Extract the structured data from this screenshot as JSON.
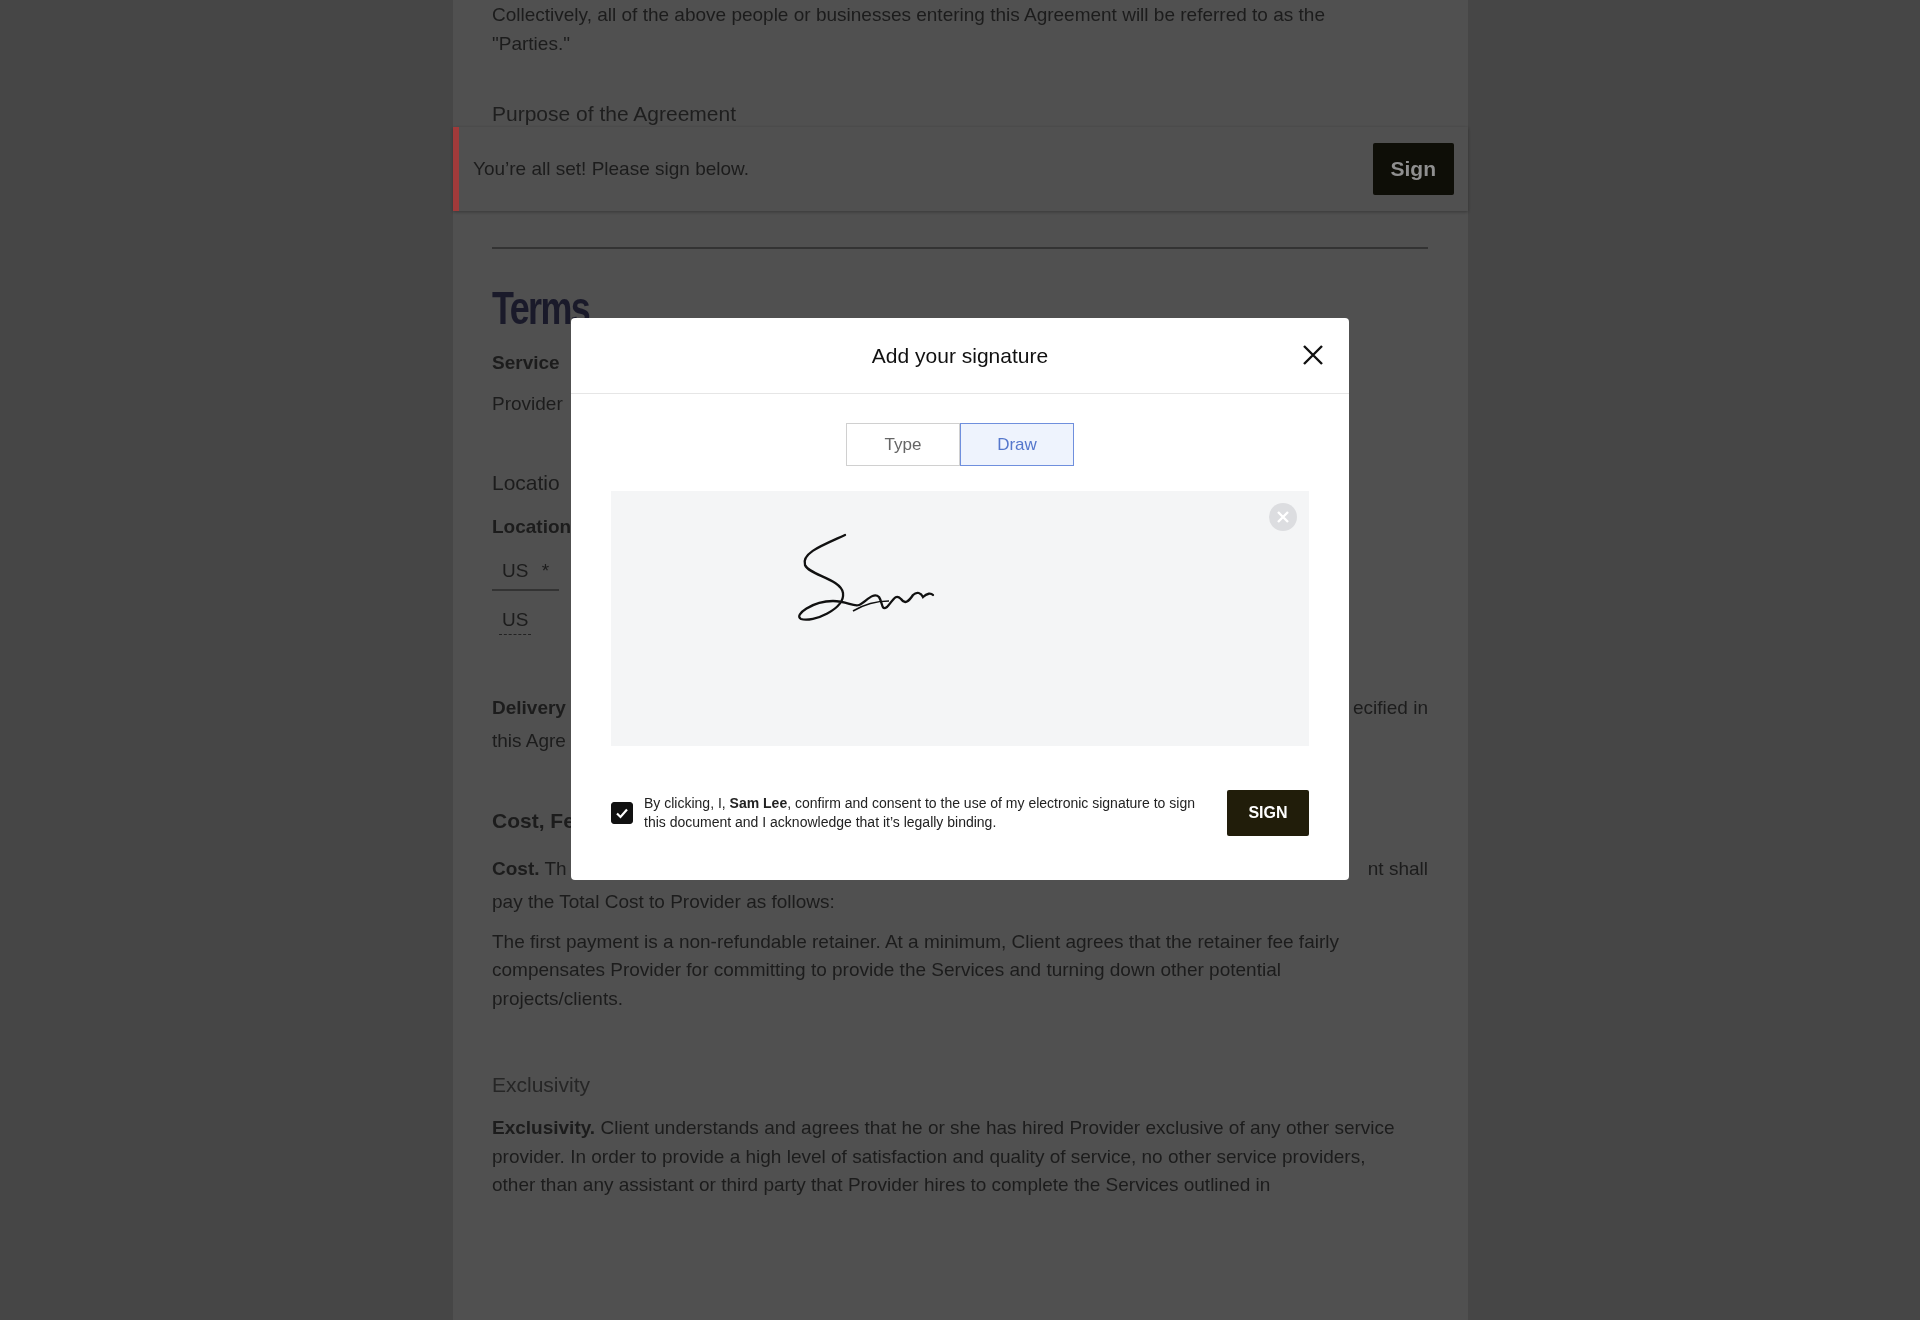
{
  "document": {
    "intro": "Collectively, all of the above people or businesses entering this Agreement will be referred to as the \"Parties.\"",
    "purpose_heading": "Purpose of the Agreement",
    "terms_heading": "Terms",
    "left_fragments": [
      {
        "kind": "bold",
        "text": "Service"
      },
      {
        "kind": "plain",
        "text": "Provider"
      },
      {
        "kind": "heading",
        "text": "Locatio"
      },
      {
        "kind": "bold",
        "text": "Location"
      }
    ],
    "location_field": {
      "value": "US",
      "required_mark": "*"
    },
    "location_value": "US",
    "delivery": {
      "left": "Delivery",
      "right": "ecified in",
      "next_line": "this Agre"
    },
    "cost_heading": "Cost, Fe",
    "cost": {
      "left": "Cost.",
      "left_rest": "Th",
      "right": "nt shall",
      "next_line": "pay the Total Cost to Provider as follows:"
    },
    "retainer": "The first payment is a non-refundable retainer. At a minimum, Client agrees that the retainer fee fairly compensates Provider for committing to provide the Services and turning down other potential projects/clients.",
    "exclusivity_heading": "Exclusivity",
    "exclusivity": "**Exclusivity.** Client understands and agrees that he or she has hired Provider exclusive of any other service provider. In order to provide a high level of satisfaction and quality of service, no other service providers, other than any assistant or third party that Provider hires to complete the Services outlined in"
  },
  "banner": {
    "message": "You’re all set! Please sign below.",
    "button": "Sign"
  },
  "modal": {
    "title": "Add your signature",
    "tabs": [
      {
        "label": "Type",
        "selected": false
      },
      {
        "label": "Draw",
        "selected": true
      }
    ],
    "consent": {
      "checked": true,
      "text": "By clicking, I, **Sam Lee**, confirm and consent to the use of my electronic signature to sign this document and I acknowledge that it’s legally binding."
    },
    "sign_button": "SIGN"
  }
}
